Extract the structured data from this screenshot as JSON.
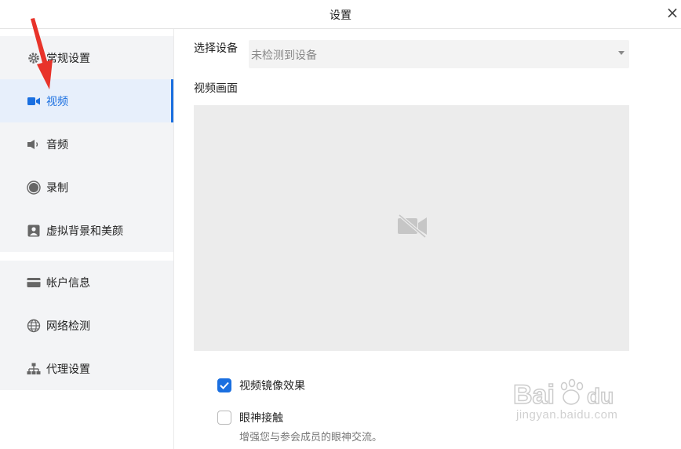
{
  "window": {
    "title": "设置",
    "close_glyph": "×"
  },
  "sidebar": {
    "groups": [
      {
        "items": [
          {
            "label": "常规设置",
            "icon": "gear-icon"
          },
          {
            "label": "视频",
            "icon": "video-camera-icon",
            "active": true
          },
          {
            "label": "音频",
            "icon": "speaker-icon"
          },
          {
            "label": "录制",
            "icon": "record-icon"
          },
          {
            "label": "虚拟背景和美颜",
            "icon": "portrait-icon"
          }
        ]
      },
      {
        "items": [
          {
            "label": "帐户信息",
            "icon": "card-icon"
          },
          {
            "label": "网络检测",
            "icon": "globe-icon"
          },
          {
            "label": "代理设置",
            "icon": "network-tree-icon"
          }
        ]
      }
    ]
  },
  "main": {
    "device_label": "选择设备",
    "device_value": "未检测到设备",
    "preview_label": "视频画面",
    "options": [
      {
        "label": "视频镜像效果",
        "checked": true
      },
      {
        "label": "眼神接触",
        "checked": false,
        "hint": "增强您与参会成员的眼神交流。"
      }
    ]
  },
  "colors": {
    "accent": "#1a6fe0",
    "arrow": "#e8332a",
    "nav_bg": "#f3f4f6",
    "active_bg": "#e7effb"
  },
  "watermark": {
    "text": "jingyan.baidu.com"
  }
}
